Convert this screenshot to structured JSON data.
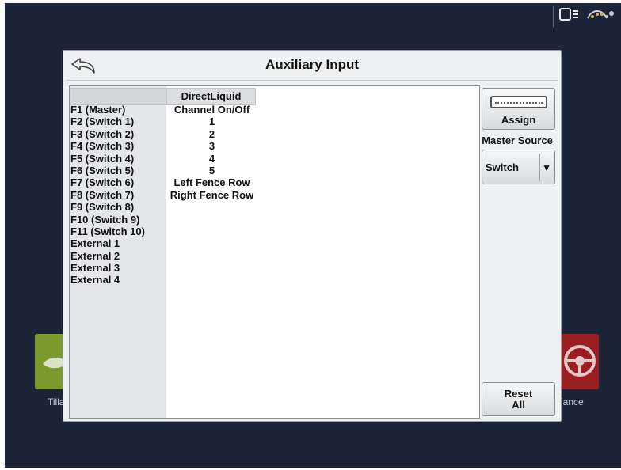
{
  "background": {
    "left_tile_label": "Tilla",
    "right_tile_label": "lance",
    "status_icons": [
      "display-icon",
      "satellite-icon"
    ],
    "colors": {
      "screen": "#1c2538",
      "left_tile": "#7a9a2e",
      "right_tile": "#9a1f22"
    }
  },
  "dialog": {
    "title": "Auxiliary Input",
    "back_icon": "back-arrow-icon"
  },
  "table": {
    "column_header": "DirectLiquid",
    "inputs": [
      "F1 (Master)",
      "F2 (Switch 1)",
      "F3 (Switch 2)",
      "F4 (Switch 3)",
      "F5 (Switch 4)",
      "F6 (Switch 5)",
      "F7 (Switch 6)",
      "F8 (Switch 7)",
      "F9 (Switch 8)",
      "F10 (Switch 9)",
      "F11 (Switch 10)",
      "External 1",
      "External 2",
      "External 3",
      "External 4"
    ],
    "assignments": [
      "Channel On/Off",
      "1",
      "2",
      "3",
      "4",
      "5",
      "Left Fence Row",
      "Right Fence Row"
    ]
  },
  "side": {
    "assign_label": "Assign",
    "assign_icon": "keypad-icon",
    "master_source_label": "Master Source",
    "master_source_value": "Switch",
    "reset_line1": "Reset",
    "reset_line2": "All"
  }
}
